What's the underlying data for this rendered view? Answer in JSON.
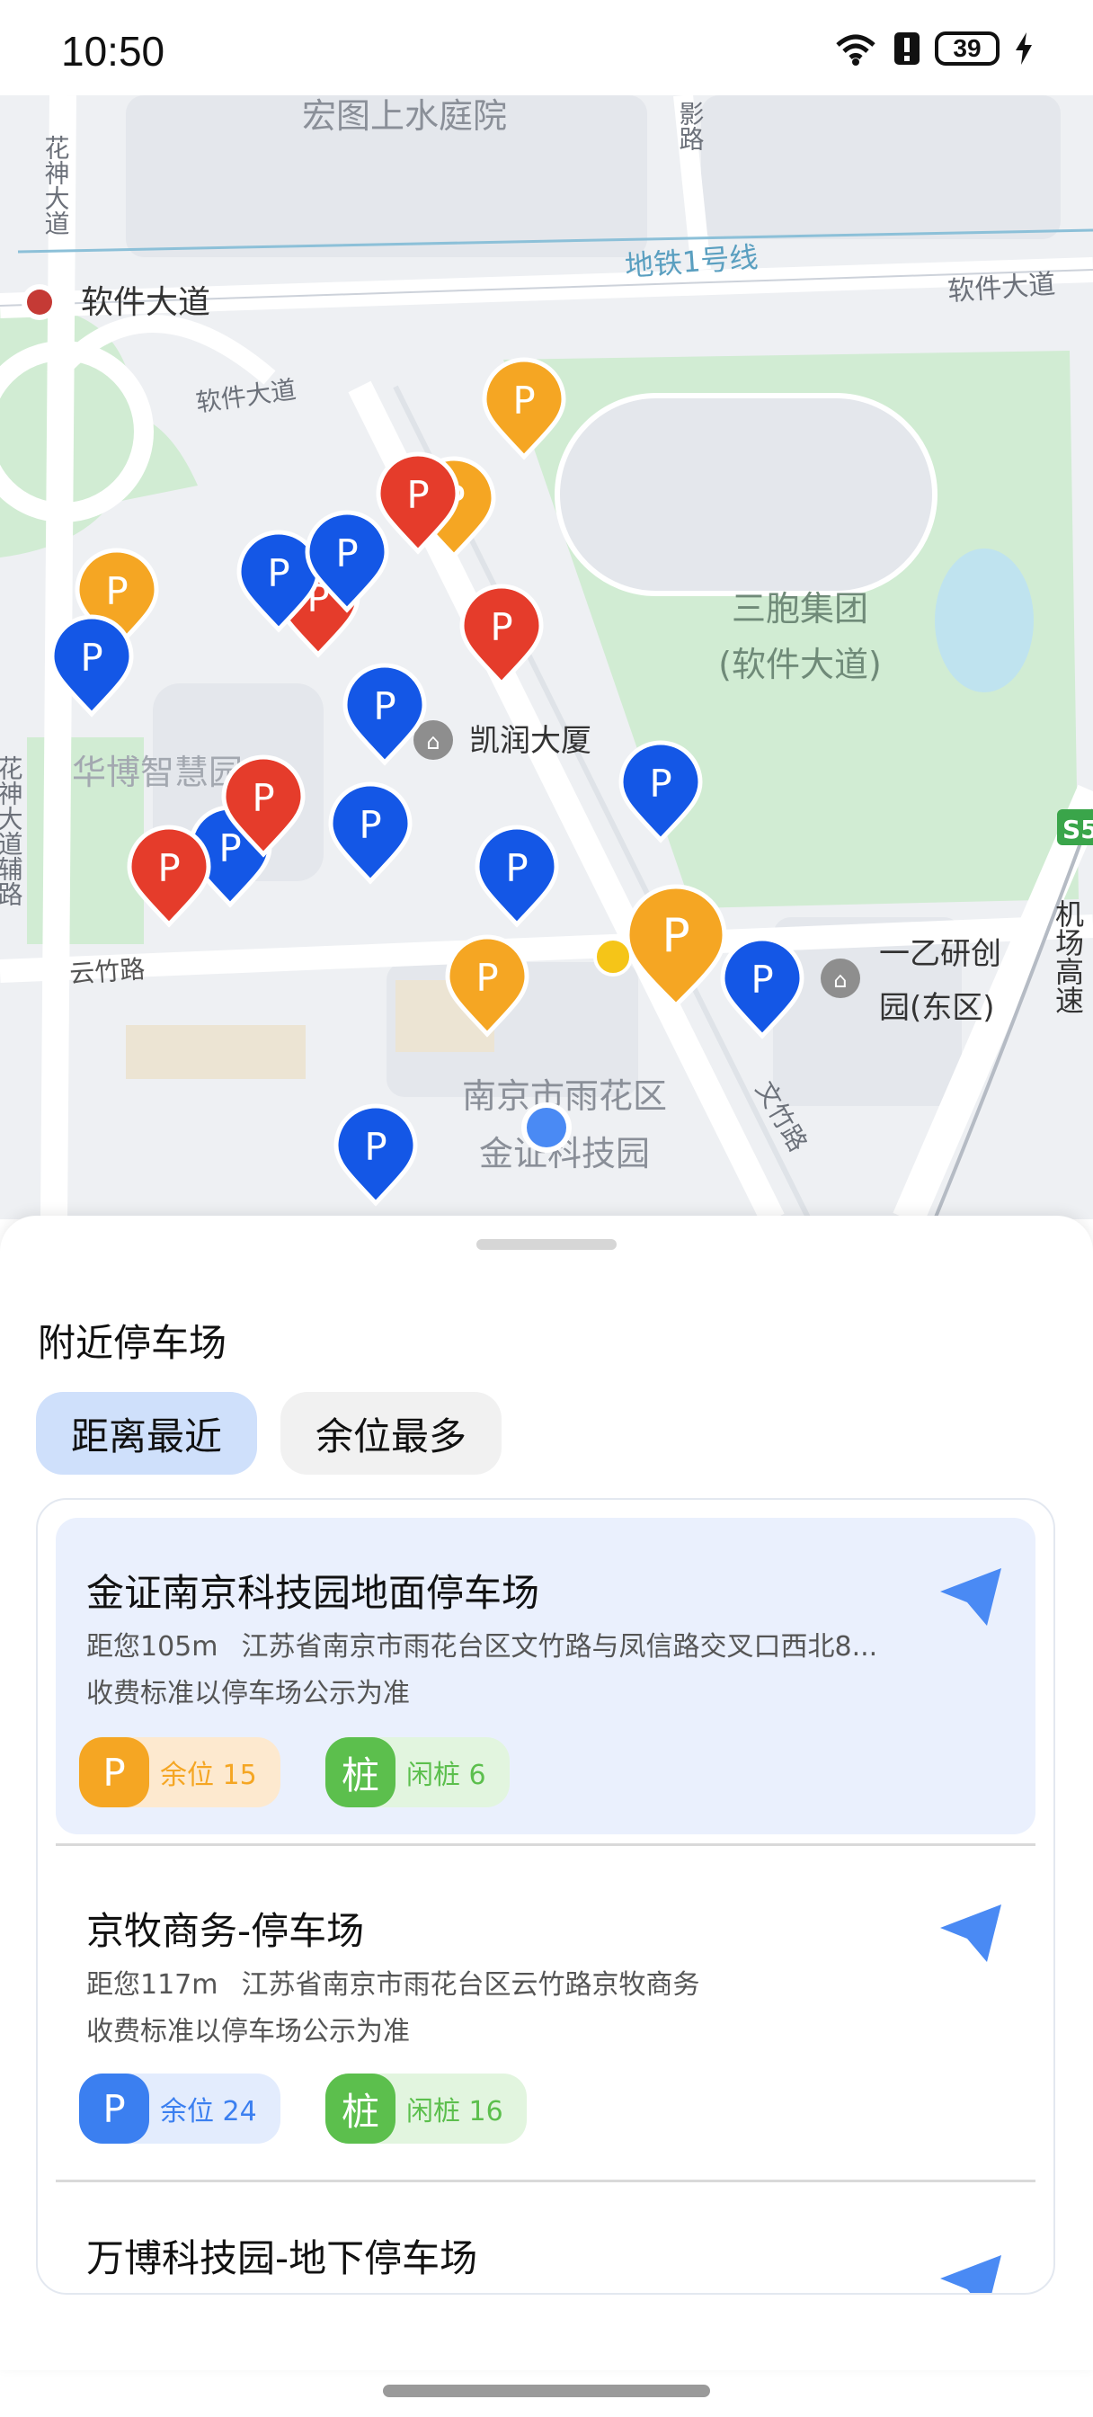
{
  "status_bar": {
    "time": "10:50",
    "battery": "39"
  },
  "map": {
    "labels": {
      "residence": "宏图上水庭院",
      "road_huashen": "花神大道",
      "road_ying": "影路",
      "metro_line": "地铁1号线",
      "metro_station": "软件大道",
      "road_ruanjian_right": "软件大道",
      "road_ruanjian_left": "软件大道",
      "sanbao_line1": "三胞集团",
      "sanbao_line2": "(软件大道)",
      "kairun": "凯润大厦",
      "huabo": "华博智慧园",
      "road_huashen_fudao": "花神大道辅路",
      "road_yunzhu": "云竹路",
      "yiyi_line1": "一乙研创",
      "yiyi_line2": "园(东区)",
      "jinzheng_line1": "南京市雨花区",
      "jinzheng_line2": "金证科技园",
      "road_wenzhu": "文竹路",
      "highway_badge": "S5",
      "edge_text": "机场高速",
      "pin_letter": "P"
    }
  },
  "sheet": {
    "title": "附近停车场",
    "tabs": [
      "距离最近",
      "余位最多"
    ],
    "lots": [
      {
        "name": "金证南京科技园地面停车场",
        "distance": "距您105m",
        "address": "江苏省南京市雨花台区文竹路与凤信路交叉口西北8...",
        "fee": "收费标准以停车场公示为准",
        "parking_icon": "P",
        "parking_label": "余位 15",
        "charger_icon": "桩",
        "charger_label": "闲桩 6",
        "parking_color": "#f5a623"
      },
      {
        "name": "京牧商务-停车场",
        "distance": "距您117m",
        "address": "江苏省南京市雨花台区云竹路京牧商务",
        "fee": "收费标准以停车场公示为准",
        "parking_icon": "P",
        "parking_label": "余位 24",
        "charger_icon": "桩",
        "charger_label": "闲桩 16",
        "parking_color": "#3b7ff0"
      },
      {
        "name": "万博科技园-地下停车场"
      }
    ]
  },
  "colors": {
    "accent": "#3b7ff0",
    "orange_pin": "#f5a623",
    "blue_pin": "#1457e6",
    "red_pin": "#e53c2b",
    "green_charger": "#5cbf4d",
    "park_green": "#d1ecd3"
  }
}
